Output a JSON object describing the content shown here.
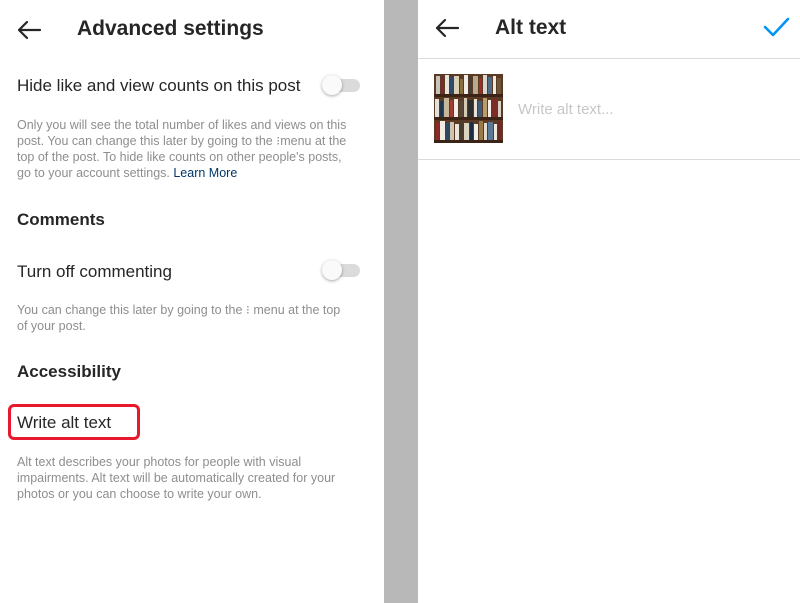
{
  "left": {
    "title": "Advanced settings",
    "hide_counts": {
      "label": "Hide like and view counts on this post",
      "help_1": "Only you will see the total number of likes and views on this",
      "help_2a": "post. You can change this later by going to the",
      "help_2b": "menu at the",
      "help_3": "top of the post. To hide like counts on other people's posts,",
      "help_4": "go to your account settings.",
      "learn_more": "Learn More",
      "enabled": false
    },
    "comments": {
      "heading": "Comments",
      "label": "Turn off commenting",
      "help_1a": "You can change this later by going to the",
      "help_1b": "menu at the top",
      "help_2": "of your post.",
      "enabled": false
    },
    "accessibility": {
      "heading": "Accessibility",
      "alt_text_label": "Write alt text",
      "help_1": "Alt text describes your photos for people with visual",
      "help_2": "impairments. Alt text will be automatically created for your",
      "help_3": "photos or you can choose to write your own."
    }
  },
  "right": {
    "title": "Alt text",
    "input_placeholder": "Write alt text...",
    "input_value": ""
  },
  "colors": {
    "accent": "#0095f6",
    "link": "#00376b",
    "highlight": "#e8192c",
    "divider": "#b8b8b8"
  },
  "icons": {
    "back": "back-arrow-icon",
    "confirm": "checkmark-icon",
    "kebab": "vertical-dots-icon"
  }
}
